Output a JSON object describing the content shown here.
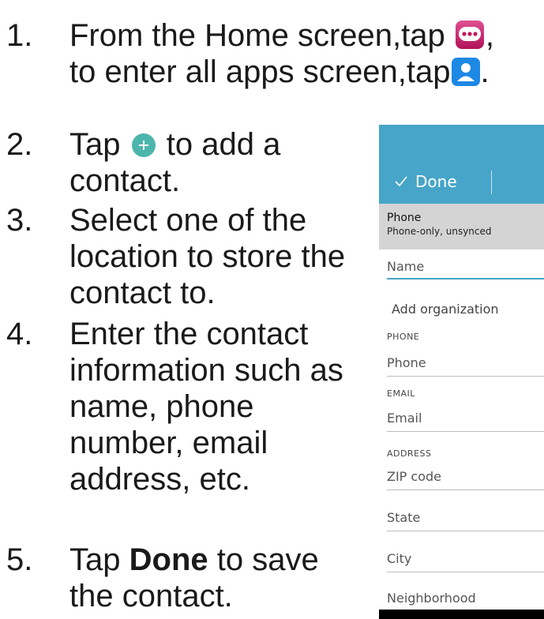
{
  "steps": [
    {
      "num": "1.",
      "lines": [
        "From the Home screen,tap",
        ",",
        "to enter all apps screen,tap",
        "."
      ]
    },
    {
      "num": "2.",
      "lines": [
        "Tap",
        "to add a",
        "contact."
      ]
    },
    {
      "num": "3.",
      "lines": [
        "Select one of the",
        "location to store the",
        "contact to."
      ]
    },
    {
      "num": "4.",
      "lines": [
        "Enter the contact",
        "information such as",
        "name, phone",
        "number, email",
        "address, etc."
      ]
    },
    {
      "num": "5.",
      "lines": [
        "Tap",
        "Done",
        "to save",
        "the contact."
      ]
    }
  ],
  "icons": {
    "apps": {
      "name": "apps-grid-icon",
      "color": "#c2185b"
    },
    "contacts": {
      "name": "contacts-person-icon",
      "color": "#1e88e5"
    },
    "add": {
      "name": "add-contact-icon",
      "color": "#4db6ac"
    }
  },
  "phone": {
    "done_label": "Done",
    "account_title": "Phone",
    "account_sub": "Phone-only, unsynced",
    "name_placeholder": "Name",
    "add_org": "Add organization",
    "phone_section": "PHONE",
    "phone_placeholder": "Phone",
    "email_section": "EMAIL",
    "email_placeholder": "Email",
    "address_section": "ADDRESS",
    "zip_placeholder": "ZIP code",
    "state_placeholder": "State",
    "city_placeholder": "City",
    "neighborhood_placeholder": "Neighborhood",
    "accent": "#46a5c8"
  }
}
